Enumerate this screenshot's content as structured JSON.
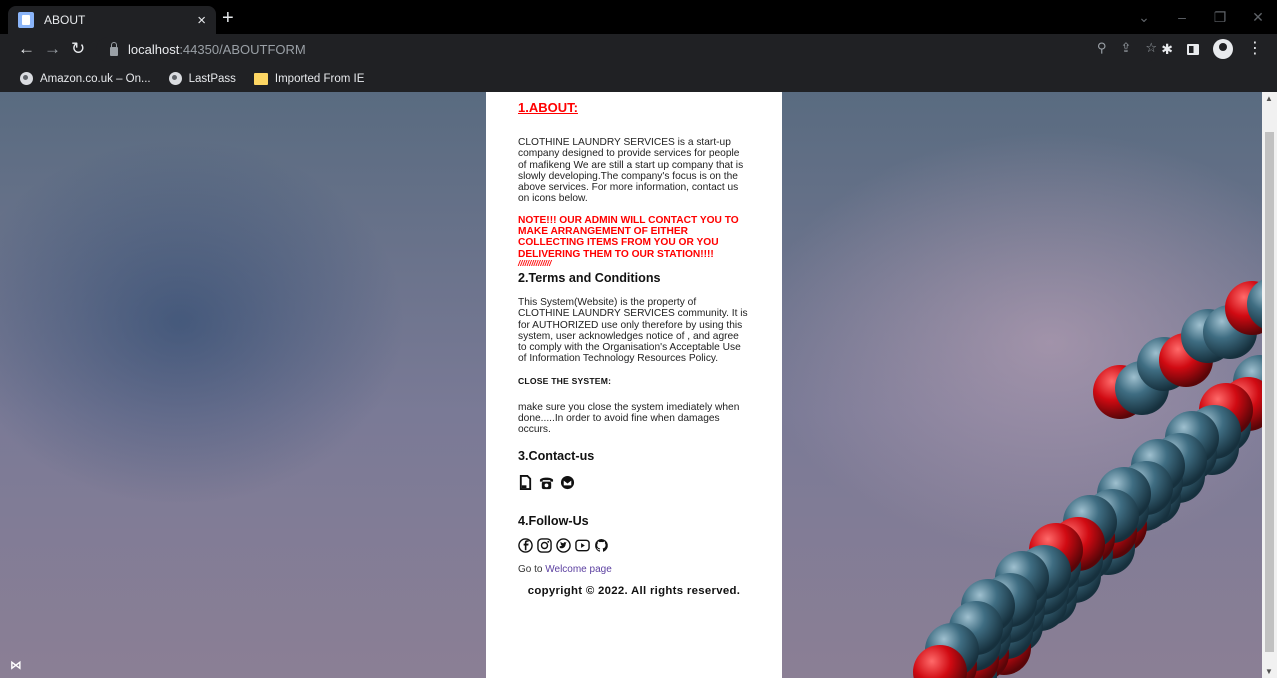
{
  "browser": {
    "tab_title": "ABOUT",
    "tab_close": "×",
    "new_tab": "+",
    "url_host": "localhost",
    "url_rest": ":44350/ABOUTFORM",
    "bookmarks": [
      {
        "label": "Amazon.co.uk – On...",
        "icon": "globe-icon"
      },
      {
        "label": "LastPass",
        "icon": "globe-icon"
      },
      {
        "label": "Imported From IE",
        "icon": "folder-icon"
      }
    ]
  },
  "page": {
    "about_heading": "1.ABOUT:",
    "about_text": "CLOTHINE LAUNDRY SERVICES is a start-up company designed to provide services for people of mafikeng We are still a start up company that is slowly developing.The company's focus is on the above services. For more information, contact us on icons below.",
    "note_text": "NOTE!!! OUR ADMIN WILL CONTACT YOU TO MAKE ARRANGEMENT OF EITHER COLLECTING ITEMS FROM YOU OR YOU DELIVERING THEM TO OUR STATION!!!!",
    "note_slashes": "///////////////",
    "terms_heading": "2.Terms and Conditions",
    "terms_text": "This System(Website) is the property of CLOTHINE LAUNDRY SERVICES community. It is for AUTHORIZED use only therefore by using this system, user acknowledges notice of , and agree to comply with the Organisation's Acceptable Use of Information Technology Resources Policy.",
    "close_heading": "CLOSE THE SYSTEM:",
    "close_text": "make sure you close the system imediately when done.....In order to avoid fine when damages occurs.",
    "contact_heading": "3.Contact-us",
    "contact_icons": [
      "phone-icon",
      "telephone-icon",
      "email-icon"
    ],
    "follow_heading": "4.Follow-Us",
    "follow_icons": [
      "facebook-icon",
      "instagram-icon",
      "twitter-icon",
      "youtube-icon",
      "github-icon"
    ],
    "goto_prefix": "Go to ",
    "goto_link": "Welcome page",
    "copyright": "copyright © 2022. All rights reserved."
  },
  "colors": {
    "accent_red": "#ff0000",
    "link_purple": "#5b3fa0"
  }
}
